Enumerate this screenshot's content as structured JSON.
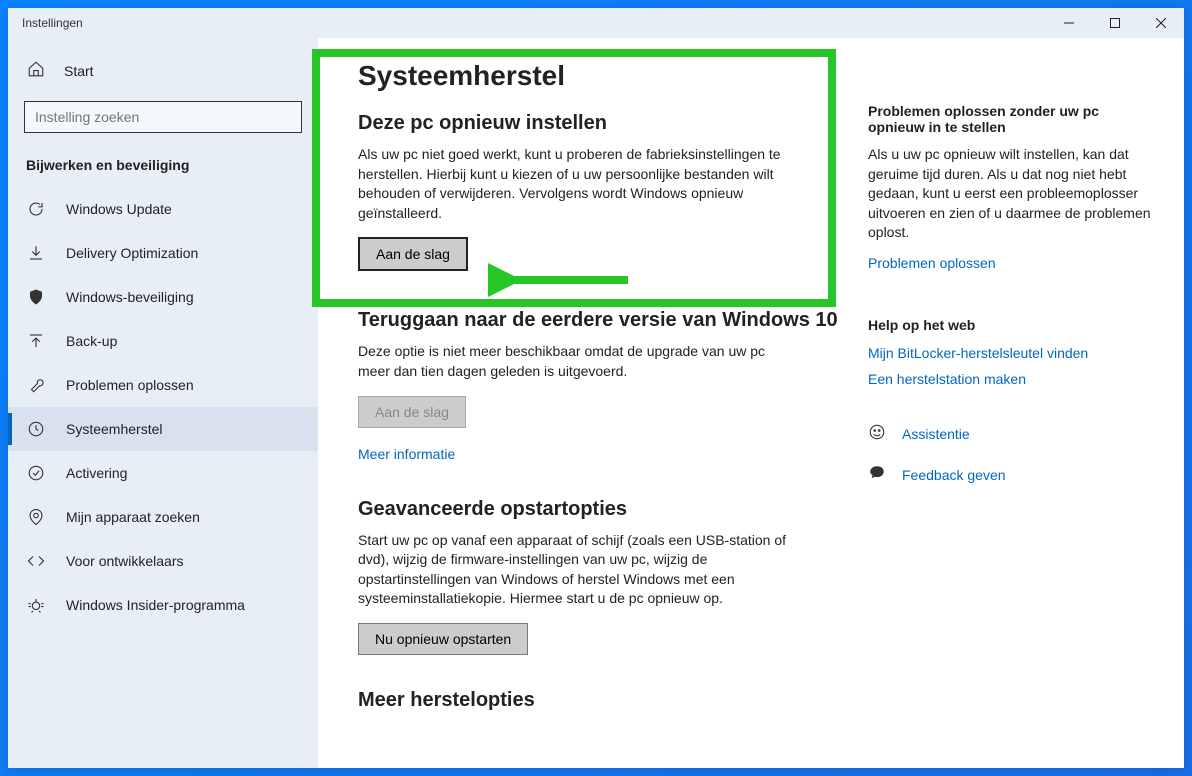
{
  "window": {
    "title": "Instellingen"
  },
  "sidebar": {
    "home_label": "Start",
    "search_placeholder": "Instelling zoeken",
    "category_label": "Bijwerken en beveiliging",
    "items": [
      {
        "label": "Windows Update"
      },
      {
        "label": "Delivery Optimization"
      },
      {
        "label": "Windows-beveiliging"
      },
      {
        "label": "Back-up"
      },
      {
        "label": "Problemen oplossen"
      },
      {
        "label": "Systeemherstel"
      },
      {
        "label": "Activering"
      },
      {
        "label": "Mijn apparaat zoeken"
      },
      {
        "label": "Voor ontwikkelaars"
      },
      {
        "label": "Windows Insider-programma"
      }
    ]
  },
  "main": {
    "page_title": "Systeemherstel",
    "reset": {
      "heading": "Deze pc opnieuw instellen",
      "text": "Als uw pc niet goed werkt, kunt u proberen de fabrieksinstellingen te herstellen. Hierbij kunt u kiezen of u uw persoonlijke bestanden wilt behouden of verwijderen. Vervolgens wordt Windows opnieuw geïnstalleerd.",
      "button": "Aan de slag"
    },
    "goback": {
      "heading": "Teruggaan naar de eerdere versie van Windows 10",
      "text": "Deze optie is niet meer beschikbaar omdat de upgrade van uw pc meer dan tien dagen geleden is uitgevoerd.",
      "button": "Aan de slag",
      "link": "Meer informatie"
    },
    "advanced": {
      "heading": "Geavanceerde opstartopties",
      "text": "Start uw pc op vanaf een apparaat of schijf (zoals een USB-station of dvd), wijzig de firmware-instellingen van uw pc, wijzig de opstartinstellingen van Windows of herstel Windows met een systeeminstallatiekopie. Hiermee start u de pc opnieuw op.",
      "button": "Nu opnieuw opstarten"
    },
    "more": {
      "heading": "Meer herstelopties"
    }
  },
  "aside": {
    "troubleshoot_heading": "Problemen oplossen zonder uw pc opnieuw in te stellen",
    "troubleshoot_text": "Als u uw pc opnieuw wilt instellen, kan dat geruime tijd duren. Als u dat nog niet hebt gedaan, kunt u eerst een probleemoplosser uitvoeren en zien of u daarmee de problemen oplost.",
    "troubleshoot_link": "Problemen oplossen",
    "help_heading": "Help op het web",
    "help_links": [
      "Mijn BitLocker-herstelsleutel vinden",
      "Een herstelstation maken"
    ],
    "actions": [
      {
        "label": "Assistentie"
      },
      {
        "label": "Feedback geven"
      }
    ]
  }
}
